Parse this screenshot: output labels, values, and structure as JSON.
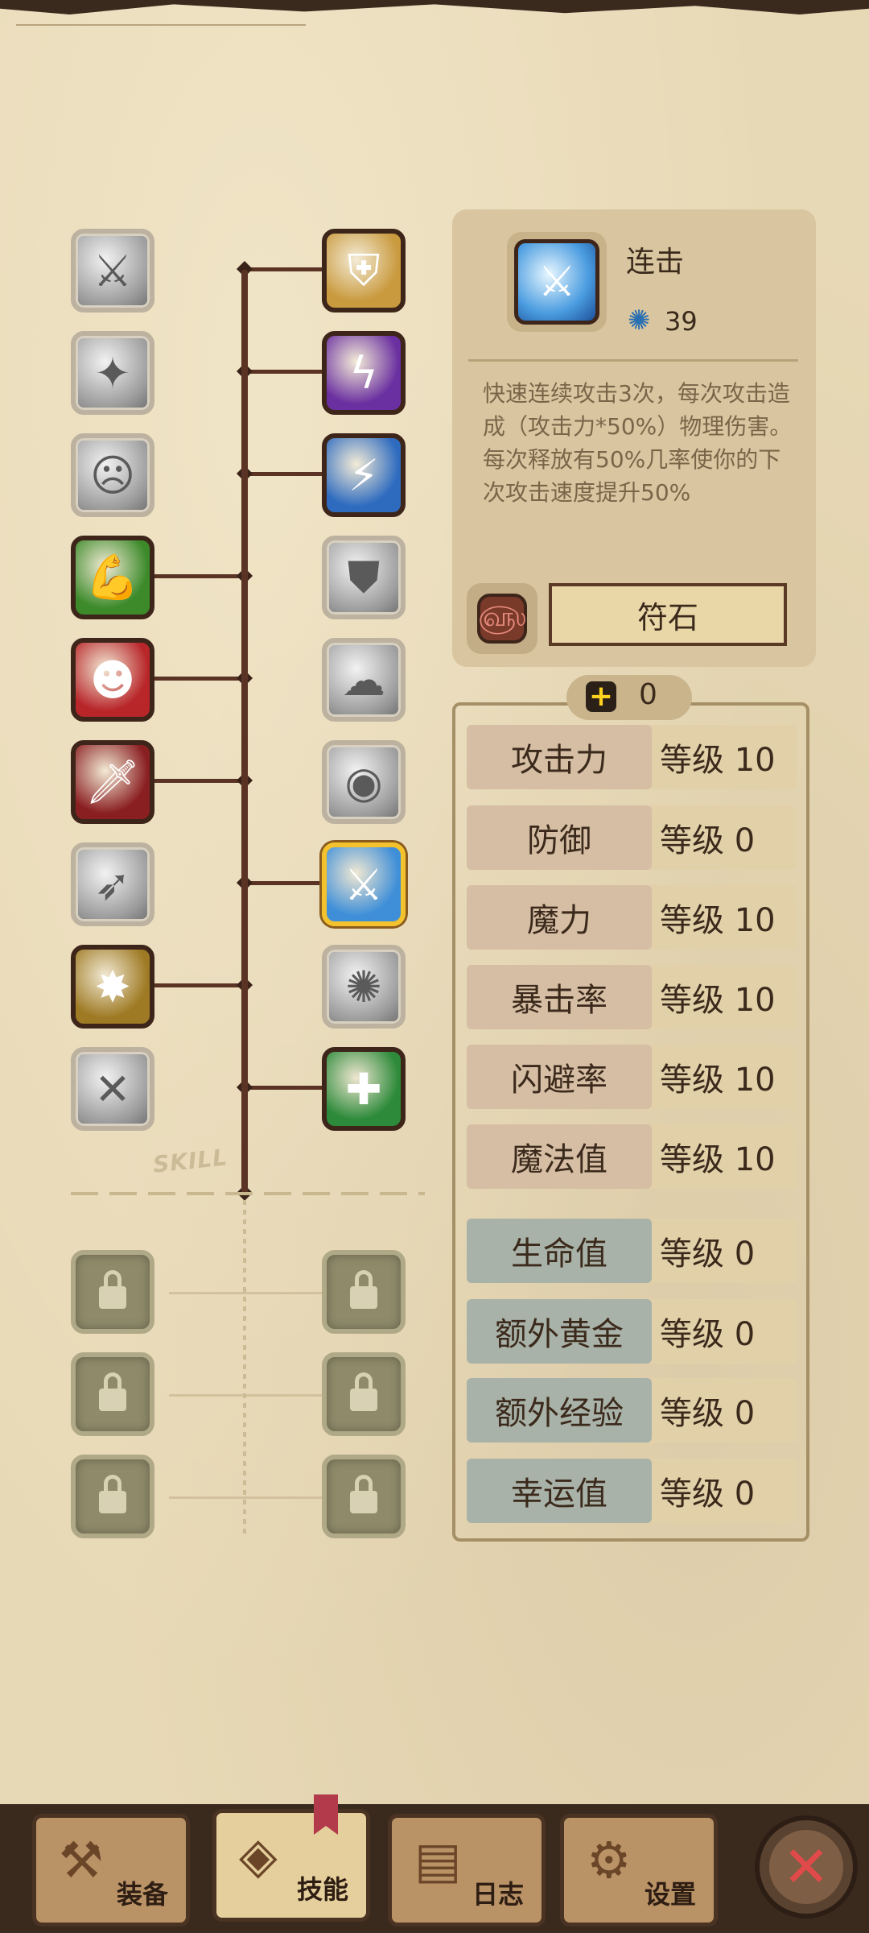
{
  "skill_tree": {
    "decor_label": "SKILL",
    "left_column": [
      {
        "icon": "blade-slash-icon",
        "state": "gray",
        "glyph": "⚔"
      },
      {
        "icon": "leaping-figure-icon",
        "state": "gray",
        "glyph": "✦"
      },
      {
        "icon": "shout-face-icon",
        "state": "gray",
        "glyph": "☹"
      },
      {
        "icon": "muscle-arm-icon",
        "state": "active",
        "glyph": "💪",
        "bg": "#3c8a2a"
      },
      {
        "icon": "red-warrior-icon",
        "state": "active",
        "glyph": "☻",
        "bg": "#b8262a"
      },
      {
        "icon": "golden-dagger-icon",
        "state": "active",
        "glyph": "🗡",
        "bg": "#8a1f22"
      },
      {
        "icon": "dash-figure-icon",
        "state": "gray",
        "glyph": "➶"
      },
      {
        "icon": "golden-burst-icon",
        "state": "active",
        "glyph": "✸",
        "bg": "#9e7a24"
      },
      {
        "icon": "crossed-swords-icon",
        "state": "gray",
        "glyph": "✕"
      }
    ],
    "right_column": [
      {
        "icon": "holy-shield-icon",
        "state": "active",
        "glyph": "⛨",
        "bg": "#c99a3e"
      },
      {
        "icon": "purple-strike-icon",
        "state": "active",
        "glyph": "ϟ",
        "bg": "#6a2fa0"
      },
      {
        "icon": "lightning-figures-icon",
        "state": "active",
        "glyph": "⚡",
        "bg": "#2e6bbf"
      },
      {
        "icon": "heavy-armor-icon",
        "state": "gray",
        "glyph": "⛊"
      },
      {
        "icon": "smoke-figures-icon",
        "state": "gray",
        "glyph": "☁"
      },
      {
        "icon": "eye-burst-icon",
        "state": "gray",
        "glyph": "◉"
      },
      {
        "icon": "combo-slash-icon",
        "state": "selected",
        "glyph": "⚔",
        "bg": "#3f8fd8"
      },
      {
        "icon": "shockwave-icon",
        "state": "gray",
        "glyph": "✺"
      },
      {
        "icon": "green-healing-icon",
        "state": "active",
        "glyph": "✚",
        "bg": "#2c8a3a"
      }
    ],
    "locked_left": [
      "locked-skill-icon",
      "locked-skill-icon",
      "locked-skill-icon"
    ],
    "locked_right": [
      "locked-skill-icon",
      "locked-skill-icon",
      "locked-skill-icon"
    ]
  },
  "info": {
    "title": "连击",
    "cost": "39",
    "cost_icon": "gear-crystal-icon",
    "description": "快速连续攻击3次，每次攻击造成（攻击力*50%）物理伤害。\n每次释放有50%几率使你的下次攻击速度提升50%",
    "rune_label": "符石",
    "rune_icon": "rune-stone-icon"
  },
  "stats": {
    "points": "0",
    "rows": [
      {
        "name": "攻击力",
        "level": "等级 10",
        "tone": "warm"
      },
      {
        "name": "防御",
        "level": "等级 0",
        "tone": "warm"
      },
      {
        "name": "魔力",
        "level": "等级 10",
        "tone": "warm"
      },
      {
        "name": "暴击率",
        "level": "等级 10",
        "tone": "warm"
      },
      {
        "name": "闪避率",
        "level": "等级 10",
        "tone": "warm"
      },
      {
        "name": "魔法值",
        "level": "等级 10",
        "tone": "warm"
      },
      {
        "name": "生命值",
        "level": "等级 0",
        "tone": "cool"
      },
      {
        "name": "额外黄金",
        "level": "等级 0",
        "tone": "cool"
      },
      {
        "name": "额外经验",
        "level": "等级 0",
        "tone": "cool"
      },
      {
        "name": "幸运值",
        "level": "等级 0",
        "tone": "cool"
      }
    ]
  },
  "tabs": [
    {
      "label": "装备",
      "icon": "axe-icon",
      "glyph": "⚒",
      "active": false
    },
    {
      "label": "技能",
      "icon": "skill-gem-icon",
      "glyph": "◈",
      "active": true
    },
    {
      "label": "日志",
      "icon": "journal-icon",
      "glyph": "▤",
      "active": false
    },
    {
      "label": "设置",
      "icon": "settings-gear-icon",
      "glyph": "⚙",
      "active": false
    }
  ],
  "close_label": "✕"
}
